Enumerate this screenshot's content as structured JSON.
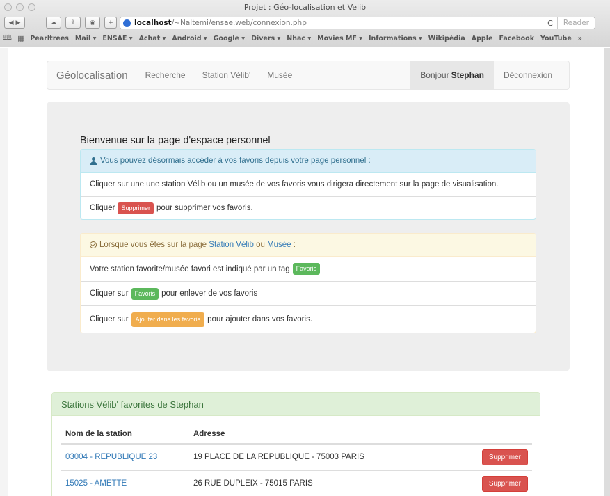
{
  "browser": {
    "title": "Projet : Géo-localisation et Velib",
    "url_host": "localhost",
    "url_path": "/~Naltemi/ensae.web/connexion.php",
    "reader_label": "Reader",
    "reload_glyph": "C",
    "bookmarks": [
      "Pearltrees",
      "Mail ▾",
      "ENSAE ▾",
      "Achat ▾",
      "Android ▾",
      "Google ▾",
      "Divers ▾",
      "Nhac ▾",
      "Movies MF ▾",
      "Informations ▾",
      "Wikipédia",
      "Apple",
      "Facebook",
      "YouTube",
      "»"
    ]
  },
  "navbar": {
    "brand": "Géolocalisation",
    "links": [
      "Recherche",
      "Station Vélib'",
      "Musée"
    ],
    "greeting": "Bonjour",
    "username": "Stephan",
    "logout": "Déconnexion"
  },
  "jumbotron": {
    "title": "Bienvenue sur la page d'espace personnel",
    "info_panel": {
      "heading": "Vous pouvez désormais accéder à vos favoris depuis votre page personnel :",
      "row1": "Cliquer sur une une station Vélib ou un musée de vos favoris vous dirigera directement sur la page de visualisation.",
      "row2_pre": "Cliquer",
      "row2_label": "Supprimer",
      "row2_post": "pour supprimer vos favoris."
    },
    "warn_panel": {
      "heading_pre": "Lorsque vous êtes sur la page",
      "heading_link1": "Station Vélib",
      "heading_mid": "ou",
      "heading_link2": "Musée",
      "heading_post": ":",
      "row1_text": "Votre station favorite/musée favori est indiqué par un tag",
      "row1_label": "Favoris",
      "row2_pre": "Cliquer sur",
      "row2_label": "Favoris",
      "row2_post": "pour enlever de vos favoris",
      "row3_pre": "Cliquer sur",
      "row3_label": "Ajouter dans les favoris",
      "row3_post": "pour ajouter dans vos favoris."
    }
  },
  "favorites": {
    "heading": "Stations Vélib' favorites de Stephan",
    "columns": [
      "Nom de la station",
      "Adresse"
    ],
    "rows": [
      {
        "name": "03004 - REPUBLIQUE 23",
        "address": "19 PLACE DE LA REPUBLIQUE - 75003 PARIS",
        "action": "Supprimer"
      },
      {
        "name": "15025 - AMETTE",
        "address": "26 RUE DUPLEIX - 75015 PARIS",
        "action": "Supprimer"
      }
    ]
  },
  "colors": {
    "info_bg": "#d9edf7",
    "warning_bg": "#fcf8e3",
    "success_bg": "#dff0d8",
    "danger": "#d9534f",
    "success": "#5cb85c",
    "warning": "#f0ad4e",
    "link": "#337ab7"
  }
}
